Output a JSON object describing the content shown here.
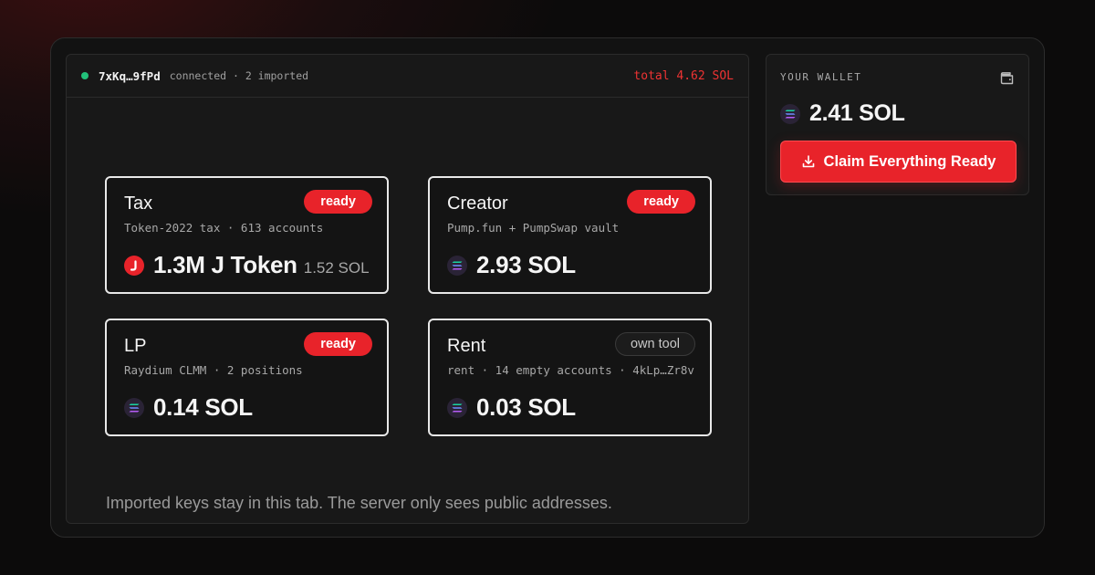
{
  "header": {
    "address": "7xKq…9fPd",
    "status": "connected · 2 imported",
    "total": "total 4.62 SOL"
  },
  "cards": [
    {
      "title": "Tax",
      "badge": "ready",
      "subtitle": "Token-2022 tax · 613 accounts",
      "amount": "1.3M J Token",
      "amount_sub": "1.52 SOL",
      "icon": "j-token-icon"
    },
    {
      "title": "Creator",
      "badge": "ready",
      "subtitle": "Pump.fun + PumpSwap vault",
      "amount": "2.93 SOL",
      "icon": "solana-icon"
    },
    {
      "title": "LP",
      "badge": "ready",
      "subtitle": "Raydium CLMM · 2 positions",
      "amount": "0.14 SOL",
      "icon": "solana-icon"
    },
    {
      "title": "Rent",
      "badge": "own tool",
      "subtitle": "rent · 14 empty accounts · 4kLp…Zr8v",
      "amount": "0.03 SOL",
      "icon": "solana-icon"
    }
  ],
  "footnote": "Imported keys stay in this tab. The server only sees public addresses.",
  "wallet": {
    "label": "YOUR WALLET",
    "balance": "2.41 SOL",
    "claim_label": "Claim Everything Ready",
    "icon": "wallet-icon"
  },
  "colors": {
    "accent": "#e8232a",
    "connected": "#22c17a",
    "total_text": "#ef3333"
  }
}
